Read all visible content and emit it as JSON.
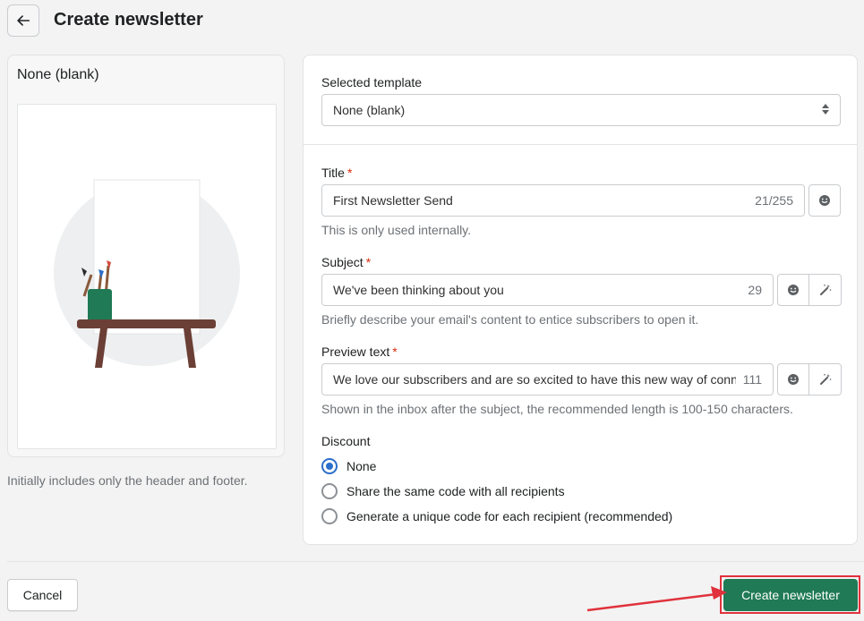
{
  "header": {
    "title": "Create newsletter",
    "back_icon": "arrow-left-icon"
  },
  "preview": {
    "template_name": "None (blank)",
    "note": "Initially includes only the header and footer."
  },
  "form": {
    "template": {
      "label": "Selected template",
      "value": "None (blank)"
    },
    "title": {
      "label": "Title",
      "required_mark": "*",
      "value": "First Newsletter Send",
      "count": "21/255",
      "help": "This is only used internally."
    },
    "subject": {
      "label": "Subject",
      "required_mark": "*",
      "value": "We've been thinking about you",
      "count": "29",
      "help": "Briefly describe your email's content to entice subscribers to open it."
    },
    "preview_text": {
      "label": "Preview text",
      "required_mark": "*",
      "value": "We love our subscribers and are so excited to have this new way of connecting with you",
      "count": "111",
      "help": "Shown in the inbox after the subject, the recommended length is 100-150 characters."
    },
    "discount": {
      "label": "Discount",
      "selected": "None",
      "options": [
        "None",
        "Share the same code with all recipients",
        "Generate a unique code for each recipient (recommended)"
      ]
    }
  },
  "footer": {
    "cancel_label": "Cancel",
    "create_label": "Create newsletter"
  },
  "colors": {
    "primary": "#1f7a55",
    "radio_selected": "#2c6ecb",
    "annotation": "#e0323c",
    "required": "#d72c0d"
  }
}
